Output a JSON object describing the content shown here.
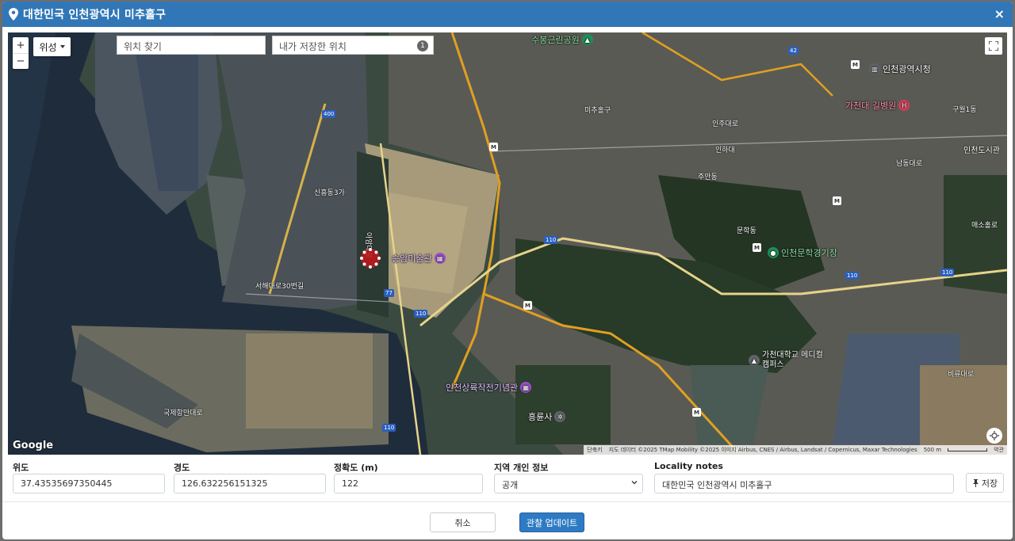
{
  "header": {
    "title": "대한민국 인천광역시 미추홀구",
    "close": "×"
  },
  "map": {
    "zoom_in": "+",
    "zoom_out": "−",
    "layer_button": "위성",
    "search_placeholder": "위치 찾기",
    "saved_placeholder": "내가 저장한 위치",
    "saved_count": "1",
    "google_logo": "Google",
    "attribution": {
      "shortcuts": "단축키",
      "data": "지도 데이터 ©2025 TMap Mobility ©2025 이미지 Airbus, CNES / Airbus, Landsat / Copernicus, Maxar Technologies",
      "scale": "500 m",
      "terms": "약관"
    },
    "pois": [
      {
        "name": "송암미술관",
        "color": "#9b4dca"
      },
      {
        "name": "인천상륙작전기념관",
        "color": "#9b4dca"
      },
      {
        "name": "흥륜사",
        "color": "#5f6368"
      },
      {
        "name": "가천대학교 메디컬캠퍼스",
        "color": "#5f6368"
      },
      {
        "name": "인천문학경기장",
        "color": "#1e8e5a"
      },
      {
        "name": "가천대 길병원",
        "color": "#d33b5a"
      },
      {
        "name": "인천광역시청",
        "color": "#5f6368"
      },
      {
        "name": "수봉근린공원",
        "color": "#1e8e5a"
      }
    ],
    "labels": [
      "인천도시관",
      "문학동",
      "구월1동",
      "비류대로",
      "매소홀로",
      "남동대로",
      "인하대",
      "주안동",
      "인주대로",
      "미추홀구",
      "서해대로30번길",
      "국제항만대로",
      "아암대로",
      "신흥동3가"
    ],
    "roads": [
      "400",
      "110",
      "110",
      "110",
      "110",
      "77",
      "110",
      "42"
    ]
  },
  "form": {
    "latitude": {
      "label": "위도",
      "value": "37.43535697350445"
    },
    "longitude": {
      "label": "경도",
      "value": "126.632256151325"
    },
    "accuracy": {
      "label": "정확도 (m)",
      "value": "122"
    },
    "privacy": {
      "label": "지역 개인 정보",
      "value": "공개"
    },
    "locality": {
      "label": "Locality notes",
      "value": "대한민국 인천광역시 미추홀구"
    },
    "save": "저장"
  },
  "footer": {
    "cancel": "취소",
    "update": "관찰 업데이트"
  },
  "colors": {
    "header": "#3177b7",
    "primary": "#2f7bc3",
    "marker": "#c4161c"
  }
}
